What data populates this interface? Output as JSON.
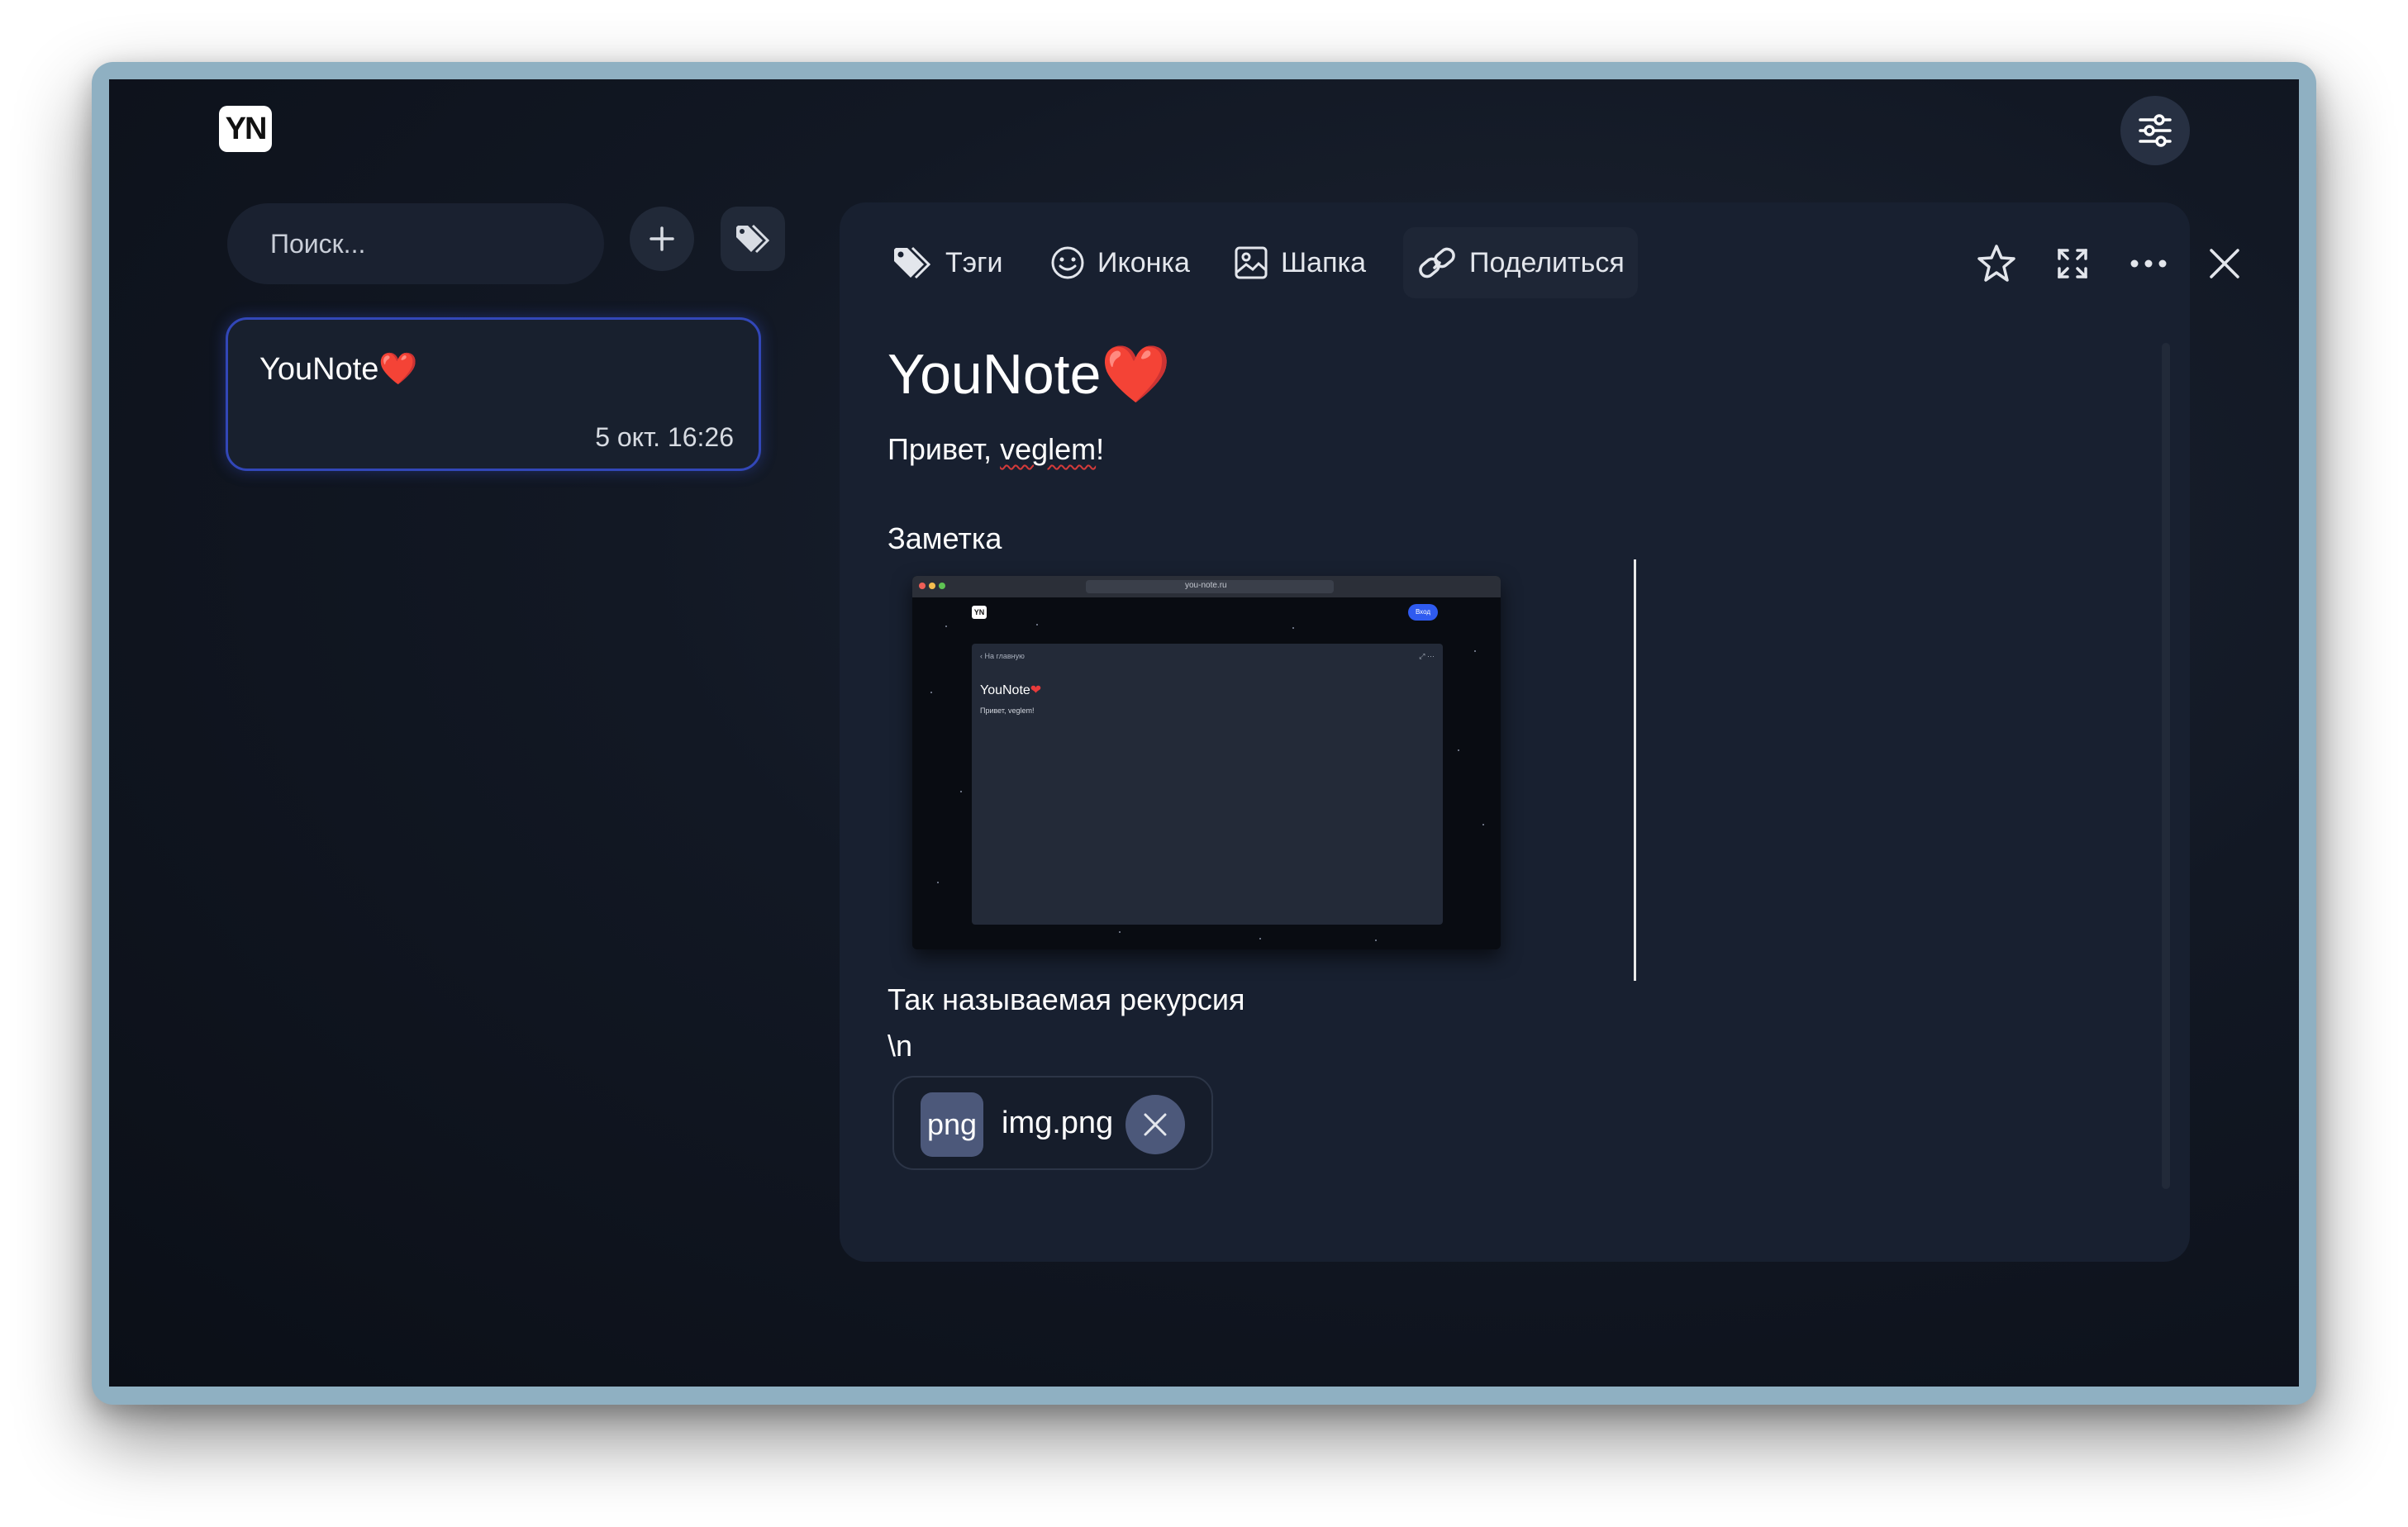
{
  "app": {
    "logo": "YN"
  },
  "sidebar": {
    "search_placeholder": "Поиск...",
    "notes": [
      {
        "title": "YouNote",
        "title_emoji": "❤️",
        "date": "5 окт. 16:26"
      }
    ]
  },
  "toolbar": {
    "tags_label": "Тэги",
    "icon_label": "Иконка",
    "cover_label": "Шапка",
    "share_label": "Поделиться"
  },
  "document": {
    "title": "YouNote",
    "title_emoji": "❤️",
    "greeting_prefix": "Привет, ",
    "greeting_name": "veglem",
    "greeting_suffix": "!",
    "section_label": "Заметка",
    "caption": "Так называемая рекурсия",
    "escape_text": "\\n",
    "attachment": {
      "ext": "png",
      "name": "img.png"
    }
  },
  "embedded_screenshot": {
    "url": "you-note.ru",
    "logo": "YN",
    "login_button": "Вход",
    "back_link": "‹ На главную",
    "note_title": "YouNote",
    "note_text": "Привет, veglem!"
  },
  "colors": {
    "accent_border": "#3247b8",
    "panel_bg": "#182030",
    "chip_bg": "#4c587a"
  }
}
